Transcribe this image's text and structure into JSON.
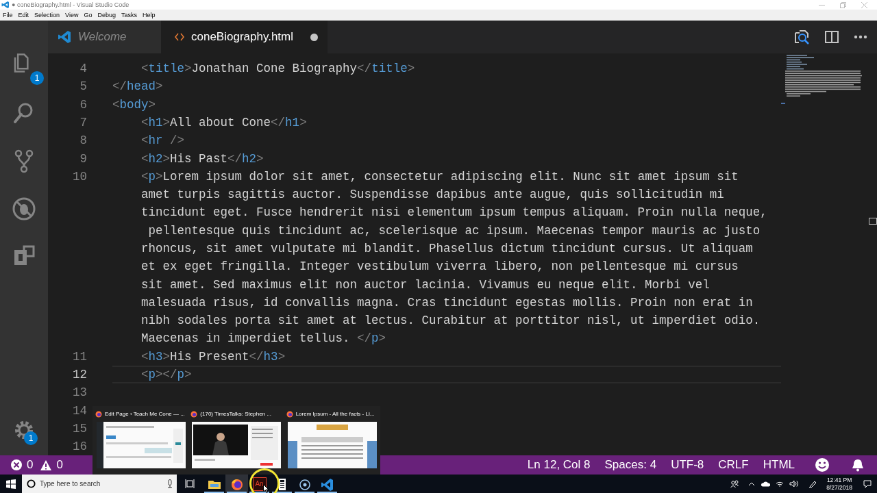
{
  "window": {
    "title": "● coneBiography.html - Visual Studio Code"
  },
  "menu": [
    "File",
    "Edit",
    "Selection",
    "View",
    "Go",
    "Debug",
    "Tasks",
    "Help"
  ],
  "activity_bar": {
    "items": [
      {
        "kind": "files",
        "badge": "1"
      },
      {
        "kind": "search"
      },
      {
        "kind": "git"
      },
      {
        "kind": "debug"
      },
      {
        "kind": "extensions"
      }
    ],
    "manage": {
      "badge": "1"
    }
  },
  "tabs": [
    {
      "label": "Welcome",
      "kind": "welcome",
      "selected": false,
      "dirty": false
    },
    {
      "label": "coneBiography.html",
      "kind": "html",
      "selected": true,
      "dirty": true
    }
  ],
  "editor": {
    "lines": [
      {
        "number": "4",
        "rows": [
          "    <title>Jonathan Cone Biography</title>"
        ],
        "current": false
      },
      {
        "number": "5",
        "rows": [
          "</head>"
        ],
        "current": false
      },
      {
        "number": "6",
        "rows": [
          "<body>"
        ],
        "current": false
      },
      {
        "number": "7",
        "rows": [
          "    <h1>All about Cone</h1>"
        ],
        "current": false
      },
      {
        "number": "8",
        "rows": [
          "    <hr />"
        ],
        "current": false
      },
      {
        "number": "9",
        "rows": [
          "    <h2>His Past</h2>"
        ],
        "current": false
      },
      {
        "number": "10",
        "rows": [
          "    <p>Lorem ipsum dolor sit amet, consectetur adipiscing elit. Nunc sit amet ipsum sit",
          "amet turpis sagittis auctor. Suspendisse dapibus ante augue, quis sollicitudin mi",
          "tincidunt eget. Fusce hendrerit nisi elementum ipsum tempus aliquam. Proin nulla neque,",
          " pellentesque quis tincidunt ac, scelerisque ac ipsum. Maecenas tempor mauris ac justo",
          "rhoncus, sit amet vulputate mi blandit. Phasellus dictum tincidunt cursus. Ut aliquam",
          "et ex eget fringilla. Integer vestibulum viverra libero, non pellentesque mi cursus",
          "sit amet. Sed maximus elit non auctor lacinia. Vivamus eu neque elit. Morbi vel",
          "malesuada risus, id convallis magna. Cras tincidunt egestas mollis. Proin non erat in",
          "nibh sodales porta sit amet at lectus. Curabitur at porttitor nisl, ut imperdiet odio.",
          "Maecenas in imperdiet tellus. </p>"
        ],
        "current": false
      },
      {
        "number": "11",
        "rows": [
          "    <h3>His Present</h3>"
        ],
        "current": false
      },
      {
        "number": "12",
        "rows": [
          "    <p></p>"
        ],
        "current": true
      },
      {
        "number": "13",
        "rows": [
          ""
        ],
        "current": false
      },
      {
        "number": "14",
        "rows": [
          ""
        ],
        "current": false
      },
      {
        "number": "15",
        "rows": [
          ""
        ],
        "current": false
      },
      {
        "number": "16",
        "rows": [
          ""
        ],
        "current": false
      }
    ]
  },
  "status_bar": {
    "errors": "0",
    "warnings": "0",
    "items": [
      "Ln 12, Col 8",
      "Spaces: 4",
      "UTF-8",
      "CRLF",
      "HTML"
    ]
  },
  "taskbar": {
    "search_placeholder": "Type here to search",
    "apps": [
      {
        "kind": "explorer",
        "running": true,
        "selected": false
      },
      {
        "kind": "firefox",
        "running": true,
        "selected": true
      },
      {
        "kind": "animate",
        "label": "An",
        "running": true,
        "selected": false
      },
      {
        "kind": "calculator",
        "running": true,
        "selected": false
      },
      {
        "kind": "circle",
        "running": true,
        "selected": false
      },
      {
        "kind": "vscode",
        "running": true,
        "selected": false
      }
    ],
    "time": "12:41 PM",
    "date": "8/27/2018"
  },
  "window_previews": [
    {
      "title": "Edit Page ‹ Teach Me Cone — ...",
      "kind": "admin"
    },
    {
      "title": "(170) TimesTalks: Stephen ...",
      "kind": "video"
    },
    {
      "title": "Lorem Ipsum - All the facts - Li...",
      "kind": "article"
    }
  ]
}
